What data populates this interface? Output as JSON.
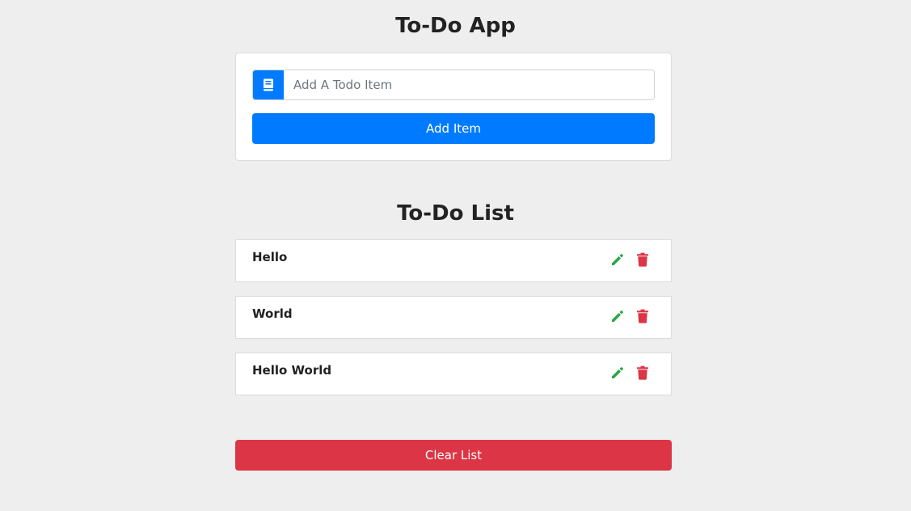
{
  "app": {
    "title": "To-Do App"
  },
  "form": {
    "input_placeholder": "Add A Todo Item",
    "input_value": "",
    "input_icon": "book-icon",
    "add_button_label": "Add Item"
  },
  "list": {
    "title": "To-Do List",
    "items": [
      {
        "text": "Hello",
        "edit_icon": "pencil-icon",
        "delete_icon": "trash-icon"
      },
      {
        "text": "World",
        "edit_icon": "pencil-icon",
        "delete_icon": "trash-icon"
      },
      {
        "text": "Hello World",
        "edit_icon": "pencil-icon",
        "delete_icon": "trash-icon"
      }
    ],
    "clear_button_label": "Clear List"
  },
  "colors": {
    "background": "#eeeeee",
    "primary": "#007bff",
    "danger": "#dc3545",
    "success": "#28a745"
  }
}
